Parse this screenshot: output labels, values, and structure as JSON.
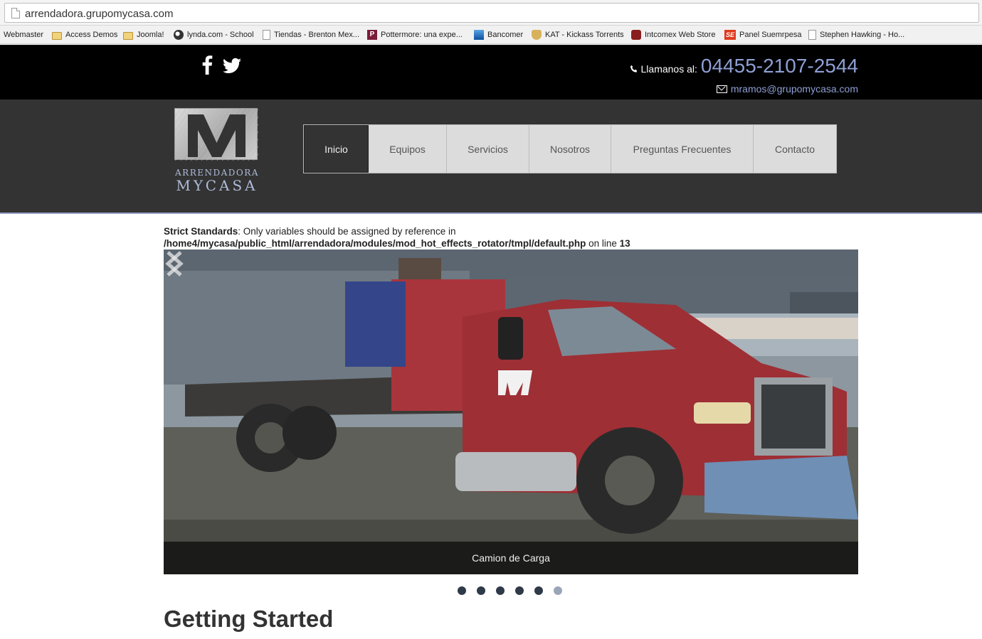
{
  "browser": {
    "url": "arrendadora.grupomycasa.com",
    "bookmarks": [
      {
        "label": "Webmaster",
        "icon": "none"
      },
      {
        "label": "Access Demos",
        "icon": "folder-icon"
      },
      {
        "label": "Joomla!",
        "icon": "folder-icon"
      },
      {
        "label": "lynda.com - School",
        "icon": "lynda-icon"
      },
      {
        "label": "Tiendas - Brenton Mex...",
        "icon": "page-icon"
      },
      {
        "label": "Pottermore: una expe...",
        "icon": "pottermore-icon"
      },
      {
        "label": "Bancomer",
        "icon": "bancomer-icon"
      },
      {
        "label": "KAT - Kickass Torrents",
        "icon": "kat-icon"
      },
      {
        "label": "Intcomex Web Store",
        "icon": "intcomex-icon"
      },
      {
        "label": "Panel Suemrpesa",
        "icon": "se-icon"
      },
      {
        "label": "Stephen Hawking - Ho...",
        "icon": "page-icon"
      }
    ]
  },
  "topbar": {
    "phone_label": "Llamanos al:",
    "phone_number": "04455-2107-2544",
    "email": "mramos@grupomycasa.com",
    "social": [
      "facebook-icon",
      "twitter-icon"
    ],
    "accent_color": "#8e9fd4"
  },
  "header": {
    "logo_line1": "ARRENDADORA",
    "logo_line2": "MYCASA",
    "nav": [
      {
        "label": "Inicio",
        "active": true
      },
      {
        "label": "Equipos",
        "active": false
      },
      {
        "label": "Servicios",
        "active": false
      },
      {
        "label": "Nosotros",
        "active": false
      },
      {
        "label": "Preguntas Frecuentes",
        "active": false
      },
      {
        "label": "Contacto",
        "active": false
      }
    ]
  },
  "notice": {
    "prefix": "Strict Standards",
    "message": ": Only variables should be assigned by reference in",
    "path": "/home4/mycasa/public_html/arrendadora/modules/mod_hot_effects_rotator/tmpl/default.php",
    "online": " on line ",
    "line": "13"
  },
  "slider": {
    "caption": "Camion de Carga",
    "slide_count": 6,
    "active_slide": 6
  },
  "content": {
    "heading": "Getting Started"
  }
}
